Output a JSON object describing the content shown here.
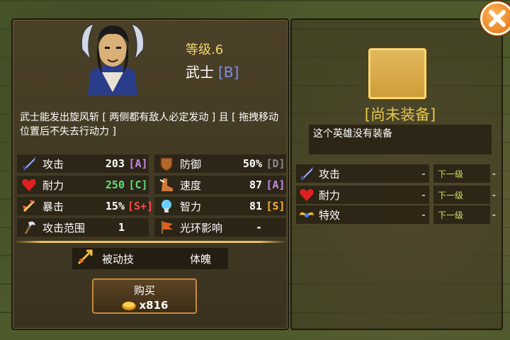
{
  "hero": {
    "level": "等级.6",
    "name": "武士",
    "rank": "[B]",
    "description": "武士能发出旋风斩 [ 两侧都有敌人必定发动 ] 且 [ 拖拽移动位置后不失去行动力 ]"
  },
  "stats": [
    {
      "label": "攻击",
      "value": "203",
      "grade": "[A]",
      "grade_color": "#c48ae8",
      "value_color": "#ffffff",
      "icon": "sword-icon"
    },
    {
      "label": "防御",
      "value": "50%",
      "grade": "[D]",
      "grade_color": "#8a8a8a",
      "value_color": "#ffffff",
      "icon": "shield-icon"
    },
    {
      "label": "耐力",
      "value": "250",
      "grade": "[C]",
      "grade_color": "#5fe07a",
      "value_color": "#5fe07a",
      "icon": "heart-icon"
    },
    {
      "label": "速度",
      "value": "87",
      "grade": "[A]",
      "grade_color": "#c48ae8",
      "value_color": "#ffffff",
      "icon": "boot-icon"
    },
    {
      "label": "暴击",
      "value": "15%",
      "grade": "[S+]",
      "grade_color": "#ff4a4a",
      "value_color": "#ffffff",
      "icon": "crit-icon"
    },
    {
      "label": "智力",
      "value": "81",
      "grade": "[S]",
      "grade_color": "#ffb030",
      "value_color": "#ffffff",
      "icon": "mind-icon"
    },
    {
      "label": "攻击范围",
      "value": "1",
      "grade": "",
      "grade_color": "#ffffff",
      "value_color": "#ffffff",
      "icon": "axe-icon"
    },
    {
      "label": "光环影响",
      "value": "-",
      "grade": "",
      "grade_color": "#ffffff",
      "value_color": "#ffffff",
      "icon": "aura-flag-icon"
    }
  ],
  "passive": {
    "label": "被动技",
    "value": "体魄"
  },
  "buy": {
    "label": "购买",
    "cost": "x816"
  },
  "equipment": {
    "title": "[尚未装备]",
    "description": "这个英雄没有装备",
    "rows": [
      {
        "label": "攻击",
        "value": "-",
        "next_label": "下一级",
        "next_value": "-",
        "icon": "sword-icon"
      },
      {
        "label": "耐力",
        "value": "-",
        "next_label": "下一级",
        "next_value": "-",
        "icon": "heart-icon"
      },
      {
        "label": "特效",
        "value": "-",
        "next_label": "下一级",
        "next_value": "-",
        "icon": "wings-icon"
      }
    ]
  }
}
